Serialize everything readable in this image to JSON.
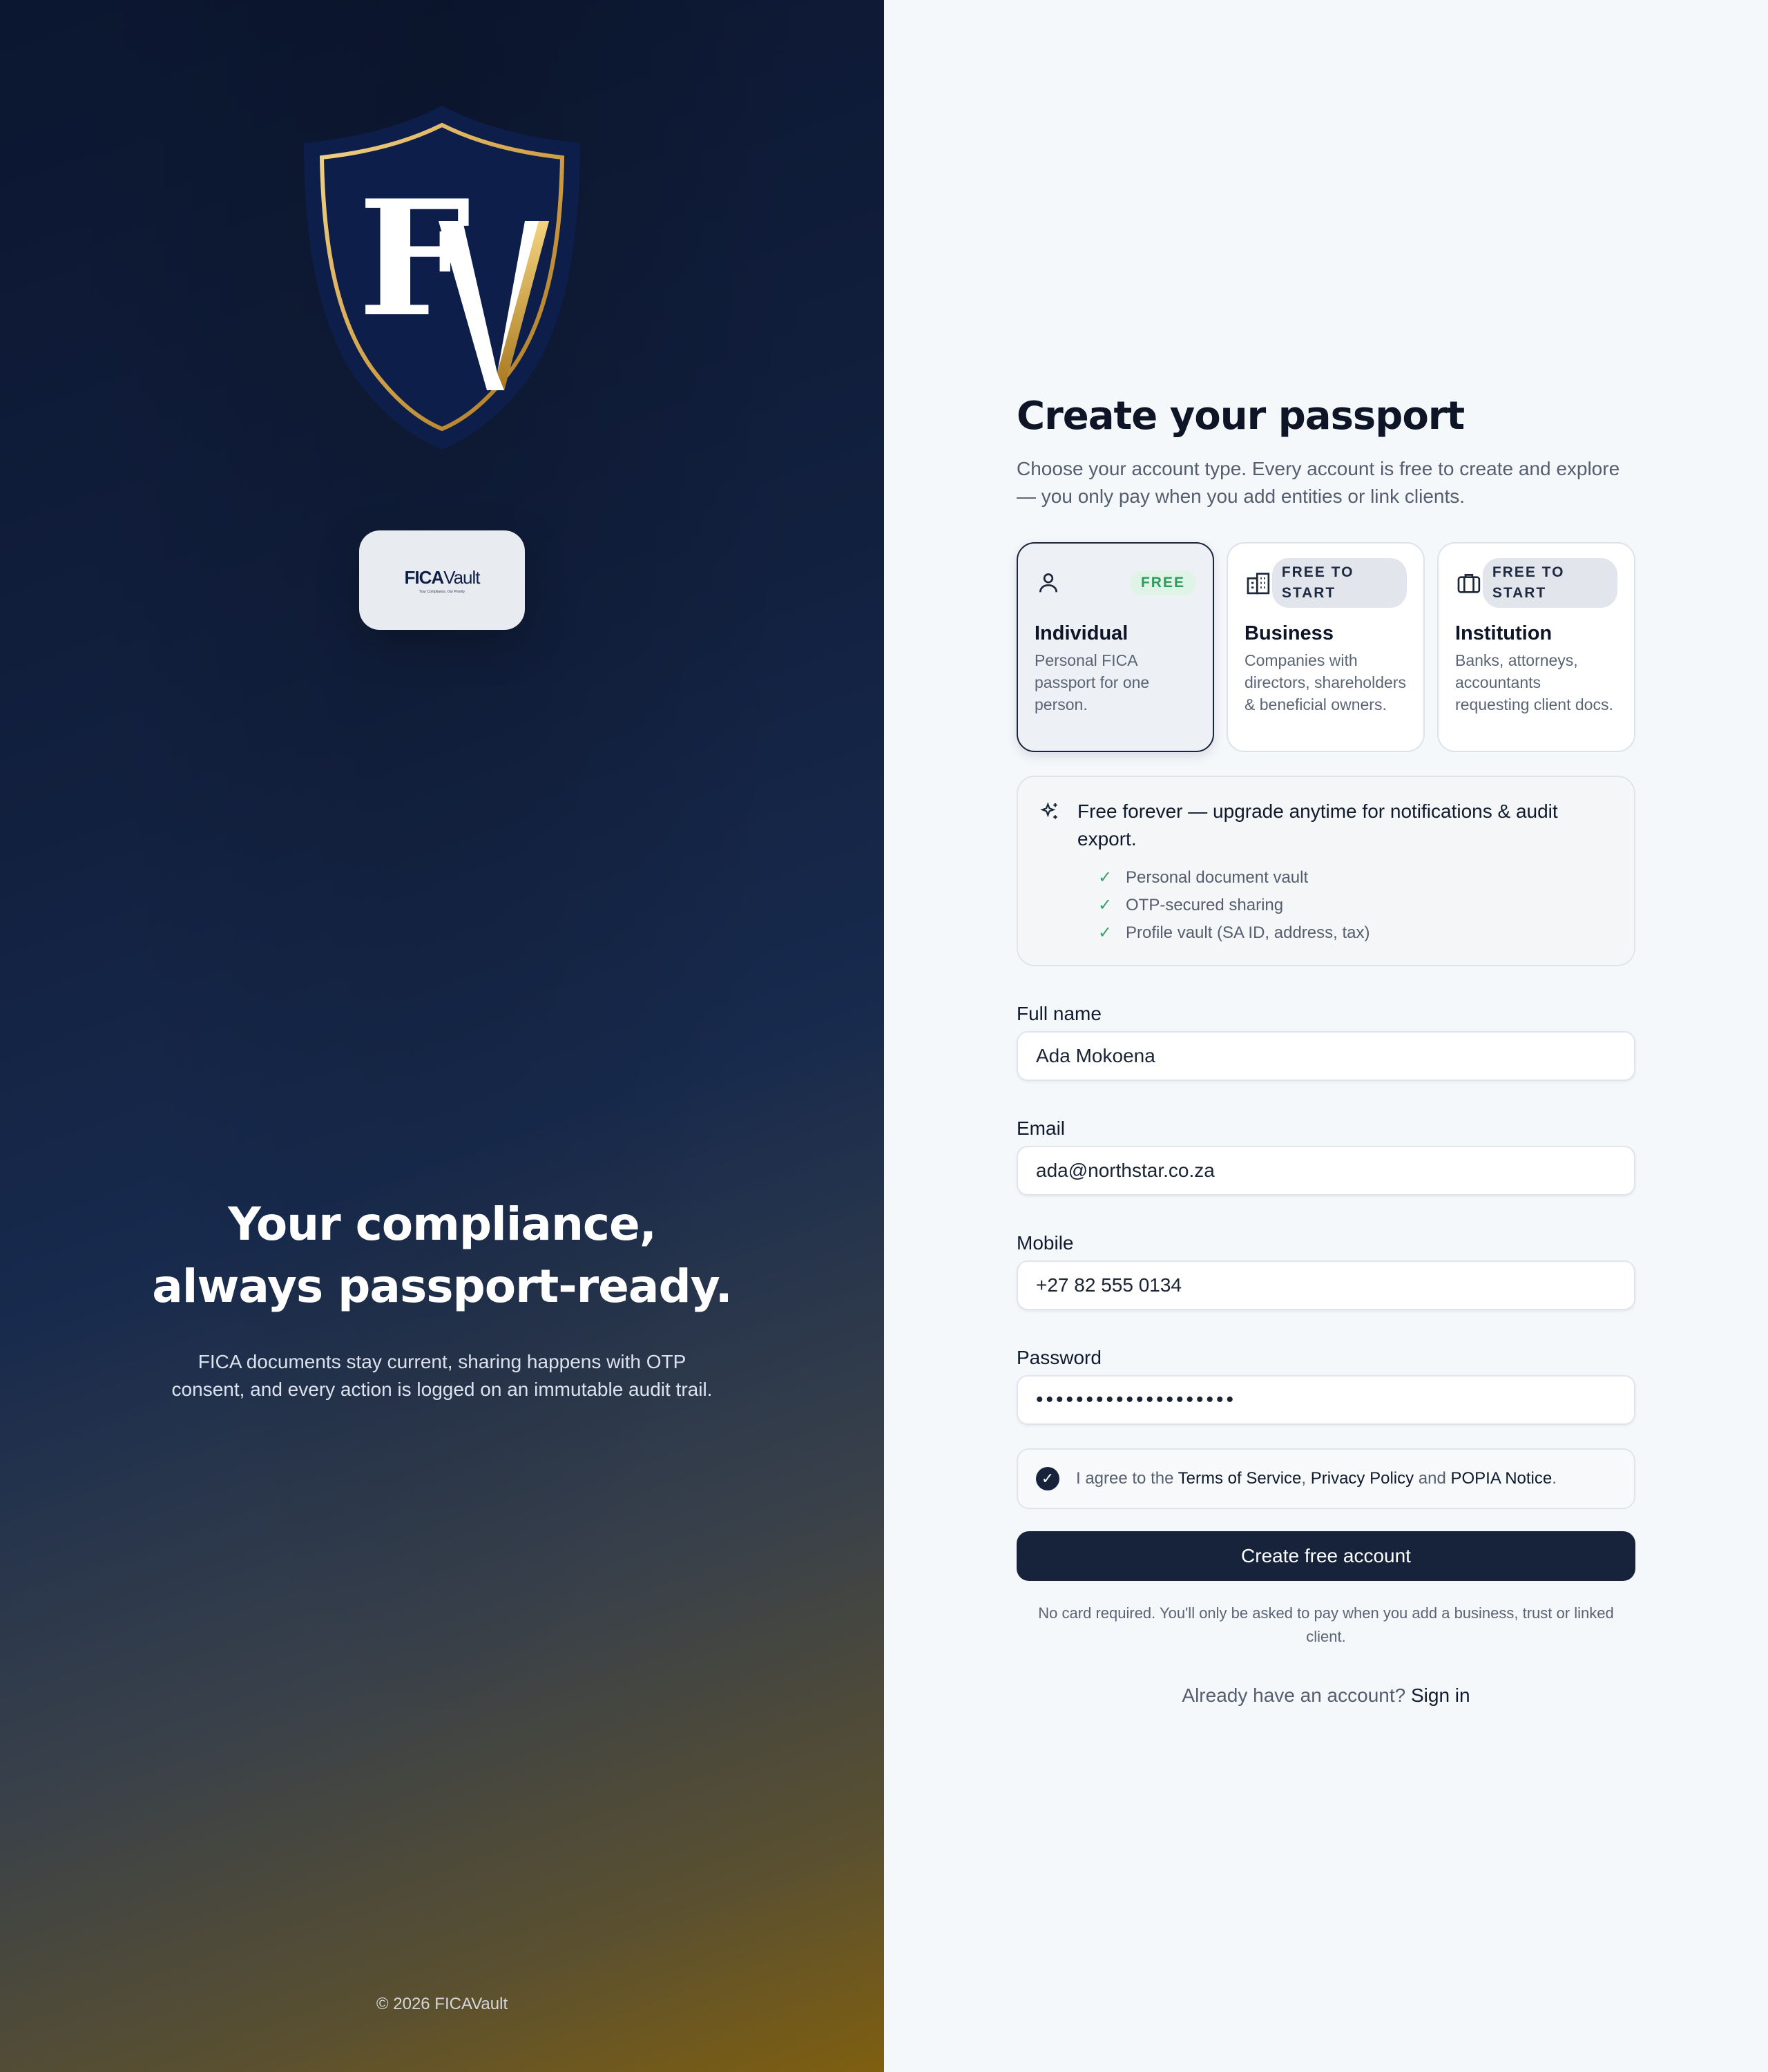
{
  "brand": {
    "monogram": "FV",
    "logo_word_bold": "FICA",
    "logo_word_light": "Vault",
    "logo_tagline": "Your Compliance, Our Priority"
  },
  "hero": {
    "line1": "Your compliance,",
    "line2": "always passport-ready.",
    "body": "FICA documents stay current, sharing happens with OTP consent, and every action is logged on an immutable audit trail."
  },
  "footer": {
    "copyright": "© 2026 FICAVault"
  },
  "form": {
    "title": "Create your passport",
    "subtitle": "Choose your account type. Every account is free to create and explore — you only pay when you add entities or link clients.",
    "account_types": [
      {
        "name": "Individual",
        "badge": "FREE",
        "description": "Personal FICA passport for one person.",
        "icon": "user-icon",
        "selected": true
      },
      {
        "name": "Business",
        "badge": "FREE TO START",
        "description": "Companies with directors, shareholders & beneficial owners.",
        "icon": "building-icon",
        "selected": false
      },
      {
        "name": "Institution",
        "badge": "FREE TO START",
        "description": "Banks, attorneys, accountants requesting client docs.",
        "icon": "briefcase-icon",
        "selected": false
      }
    ],
    "plan": {
      "title": "Free forever — upgrade anytime for notifications & audit export.",
      "features": [
        "Personal document vault",
        "OTP-secured sharing",
        "Profile vault (SA ID, address, tax)"
      ]
    },
    "fields": {
      "full_name": {
        "label": "Full name",
        "value": "Ada Mokoena"
      },
      "email": {
        "label": "Email",
        "value": "ada@northstar.co.za"
      },
      "mobile": {
        "label": "Mobile",
        "value": "+27 82 555 0134"
      },
      "password": {
        "label": "Password",
        "value": "••••••••••••••••••••"
      }
    },
    "consent": {
      "prefix": "I agree to the",
      "terms": "Terms of Service",
      "sep": ",",
      "privacy": "Privacy Policy",
      "and": "and",
      "popia": "POPIA Notice",
      "suffix": ".",
      "checked": true
    },
    "submit_label": "Create free account",
    "note": "No card required. You'll only be asked to pay when you add a business, trust or linked client.",
    "signin_prompt": "Already have an account?",
    "signin_link": "Sign in"
  },
  "colors": {
    "navy": "#16233a",
    "gold": "#d4a64a",
    "free_badge": "#2f9b5c"
  }
}
